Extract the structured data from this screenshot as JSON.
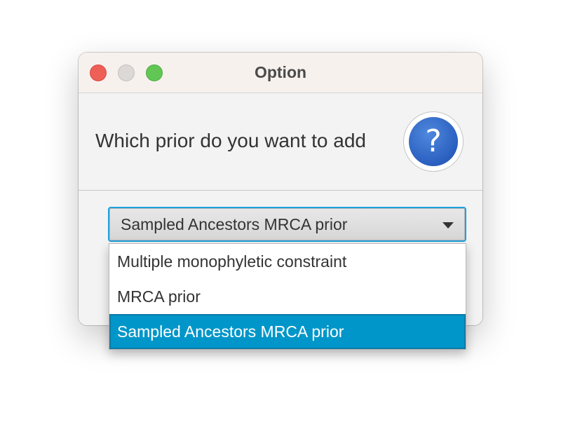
{
  "window": {
    "title": "Option",
    "controls": {
      "close": "close-button",
      "minimize": "minimize-button",
      "maximize": "maximize-button"
    }
  },
  "dialog": {
    "message": "Which prior do you want to add",
    "icon": "question-icon",
    "icon_glyph": "?"
  },
  "combo": {
    "selected": "Sampled Ancestors MRCA prior",
    "options": [
      "Multiple monophyletic constraint",
      "MRCA prior",
      "Sampled Ancestors MRCA prior"
    ],
    "selected_index": 2
  },
  "colors": {
    "accent": "#0096c9",
    "focus_ring": "#1ea2e0",
    "help_icon": "#2a5fbf",
    "close": "#ed5f57",
    "maximize": "#62c655"
  }
}
